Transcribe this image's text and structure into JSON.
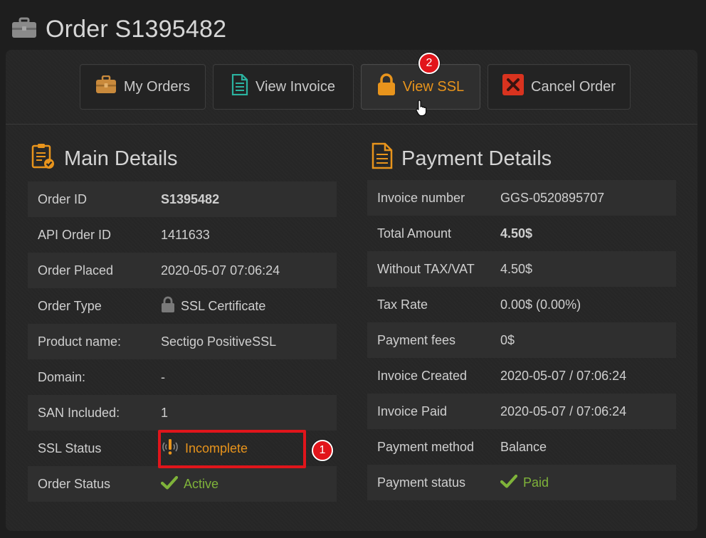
{
  "page": {
    "title": "Order S1395482",
    "title_icon": "briefcase-icon"
  },
  "toolbar": {
    "buttons": [
      {
        "label": "My Orders",
        "icon": "briefcase-icon"
      },
      {
        "label": "View Invoice",
        "icon": "document-icon"
      },
      {
        "label": "View SSL",
        "icon": "lock-icon"
      },
      {
        "label": "Cancel Order",
        "icon": "close-icon"
      }
    ]
  },
  "annotations": {
    "step1": "1",
    "step2": "2"
  },
  "main_details": {
    "title": "Main Details",
    "icon": "clipboard-check-icon",
    "rows": [
      {
        "label": "Order ID",
        "value": "S1395482"
      },
      {
        "label": "API Order ID",
        "value": "1411633"
      },
      {
        "label": "Order Placed",
        "value": "2020-05-07 07:06:24"
      },
      {
        "label": "Order Type",
        "value": "SSL Certificate",
        "icon": "lock-icon"
      },
      {
        "label": "Product name:",
        "value": "Sectigo PositiveSSL"
      },
      {
        "label": "Domain:",
        "value": "-"
      },
      {
        "label": "SAN Included:",
        "value": "1"
      },
      {
        "label": "SSL Status",
        "value": "Incomplete",
        "icon": "alert-signal-icon"
      },
      {
        "label": "Order Status",
        "value": "Active",
        "icon": "check-icon"
      }
    ]
  },
  "payment_details": {
    "title": "Payment Details",
    "icon": "document-icon",
    "rows": [
      {
        "label": "Invoice number",
        "value": "GGS-0520895707"
      },
      {
        "label": "Total Amount",
        "value": "4.50$"
      },
      {
        "label": "Without TAX/VAT",
        "value": "4.50$"
      },
      {
        "label": "Tax Rate",
        "value": "0.00$ (0.00%)"
      },
      {
        "label": "Payment fees",
        "value": "0$"
      },
      {
        "label": "Invoice Created",
        "value": "2020-05-07 / 07:06:24"
      },
      {
        "label": "Invoice Paid",
        "value": "2020-05-07 / 07:06:24"
      },
      {
        "label": "Payment method",
        "value": "Balance"
      },
      {
        "label": "Payment status",
        "value": "Paid",
        "icon": "check-icon"
      }
    ]
  },
  "colors": {
    "accent": "#e8941c",
    "success": "#7fb33a",
    "annotation": "#e2151b",
    "invoice_icon": "#2bb3a0",
    "cancel_icon": "#d9331f"
  }
}
